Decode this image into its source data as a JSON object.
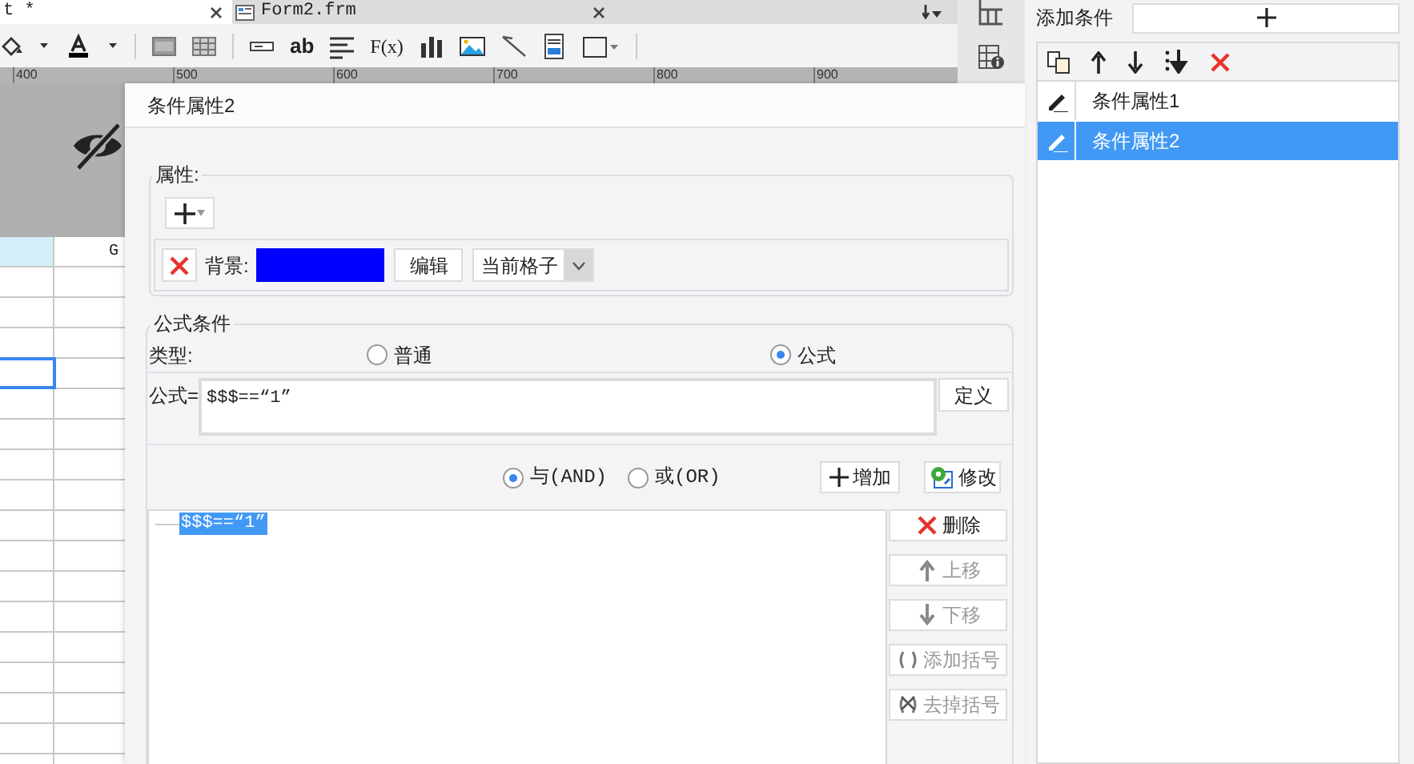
{
  "tabs": [
    {
      "label": "t *",
      "selected": true
    },
    {
      "label": "Form2.frm",
      "selected": false
    }
  ],
  "toolbar": {
    "text_icons": [
      "ab",
      "F(x)"
    ]
  },
  "ruler": {
    "ticks": [
      "400",
      "500",
      "600",
      "700",
      "800",
      "900"
    ]
  },
  "sheet": {
    "column_label": "G"
  },
  "side_panel": {
    "add_label": "添加条件",
    "items": [
      {
        "label": "条件属性1",
        "selected": false
      },
      {
        "label": "条件属性2",
        "selected": true
      }
    ]
  },
  "dialog": {
    "title": "条件属性2",
    "properties": {
      "legend": "属性:",
      "background_label": "背景:",
      "color": "#0000ff",
      "edit_button": "编辑",
      "scope": "当前格子"
    },
    "formula_condition": {
      "legend": "公式条件",
      "type_label": "类型:",
      "types": [
        {
          "label": "普通",
          "selected": false
        },
        {
          "label": "公式",
          "selected": true
        }
      ],
      "formula_label": "公式=",
      "formula": "$$$==“1”",
      "define_button": "定义",
      "logic": [
        {
          "label": "与(AND)",
          "selected": true
        },
        {
          "label": "或(OR)",
          "selected": false
        }
      ],
      "add_button": "增加",
      "modify_button": "修改",
      "conditions": [
        {
          "label": "$$$==“1”",
          "selected": true
        }
      ],
      "actions": [
        {
          "kind": "delete",
          "label": "删除",
          "disabled": false
        },
        {
          "kind": "up",
          "label": "上移",
          "disabled": true
        },
        {
          "kind": "down",
          "label": "下移",
          "disabled": true
        },
        {
          "kind": "add_paren",
          "label": "添加括号",
          "disabled": true
        },
        {
          "kind": "remove_paren",
          "label": "去掉括号",
          "disabled": true
        }
      ]
    }
  }
}
